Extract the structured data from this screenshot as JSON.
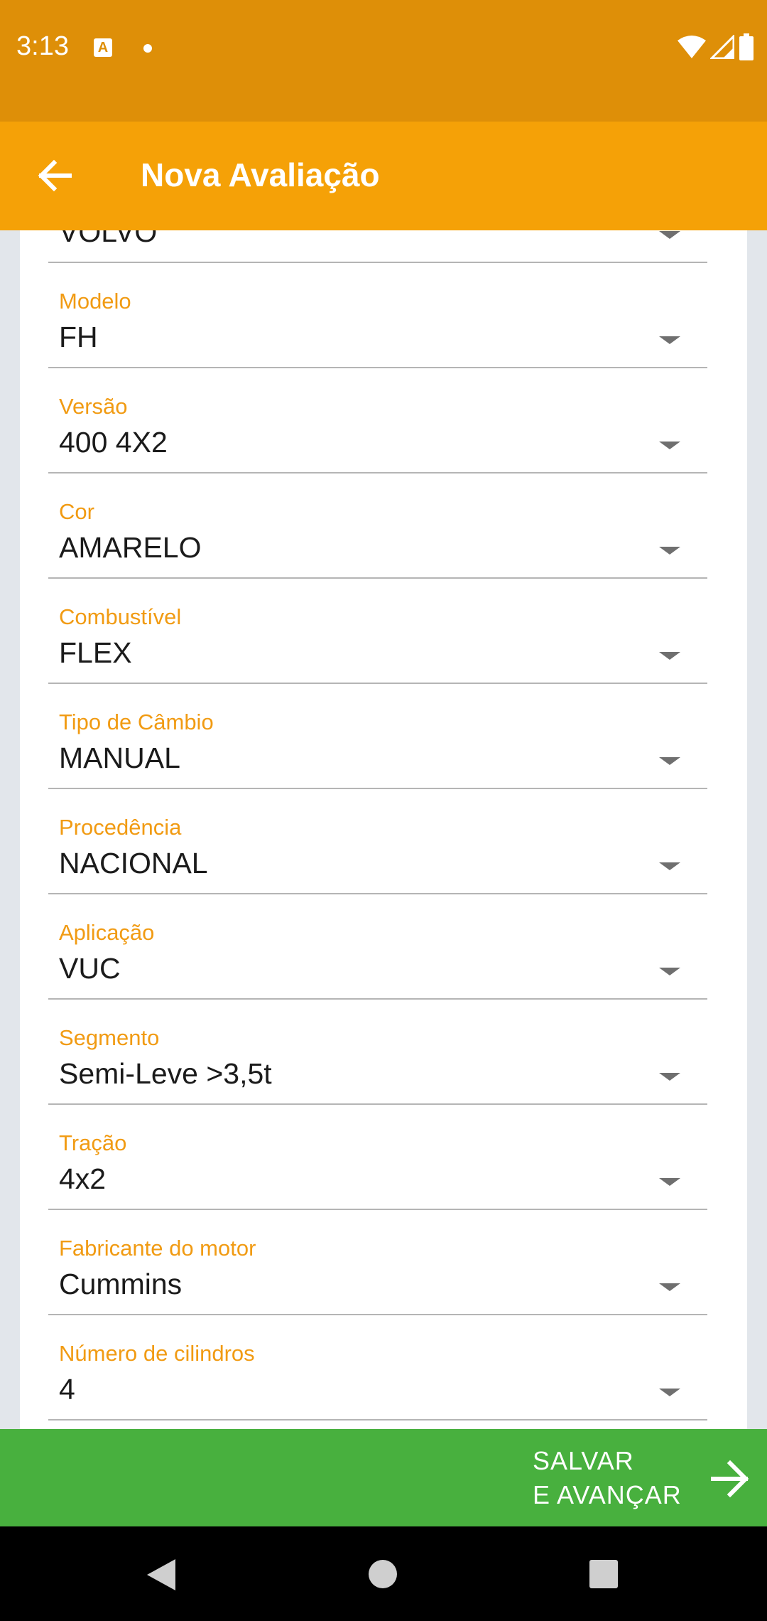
{
  "status_bar": {
    "time": "3:13",
    "app_icon_letter": "A",
    "icons": [
      "wifi-icon",
      "signal-icon",
      "battery-icon"
    ]
  },
  "app_bar": {
    "title": "Nova Avaliação",
    "back_icon": "arrow-left-icon"
  },
  "form": {
    "fields": [
      {
        "label": "",
        "value": "VOLVO"
      },
      {
        "label": "Modelo",
        "value": "FH"
      },
      {
        "label": "Versão",
        "value": "400 4X2"
      },
      {
        "label": "Cor",
        "value": "AMARELO"
      },
      {
        "label": "Combustível",
        "value": "FLEX"
      },
      {
        "label": "Tipo de Câmbio",
        "value": "MANUAL"
      },
      {
        "label": "Procedência",
        "value": "NACIONAL"
      },
      {
        "label": "Aplicação",
        "value": "VUC"
      },
      {
        "label": "Segmento",
        "value": "Semi-Leve >3,5t"
      },
      {
        "label": "Tração",
        "value": "4x2"
      },
      {
        "label": "Fabricante do motor",
        "value": "Cummins"
      },
      {
        "label": "Número de cilindros",
        "value": "4"
      }
    ]
  },
  "footer": {
    "save_line1": "SALVAR",
    "save_line2": "E AVANÇAR",
    "save_icon": "arrow-right-icon"
  },
  "colors": {
    "status_bar": "#de8f08",
    "app_bar": "#f5a107",
    "label": "#f19b13",
    "footer": "#48b03e"
  }
}
